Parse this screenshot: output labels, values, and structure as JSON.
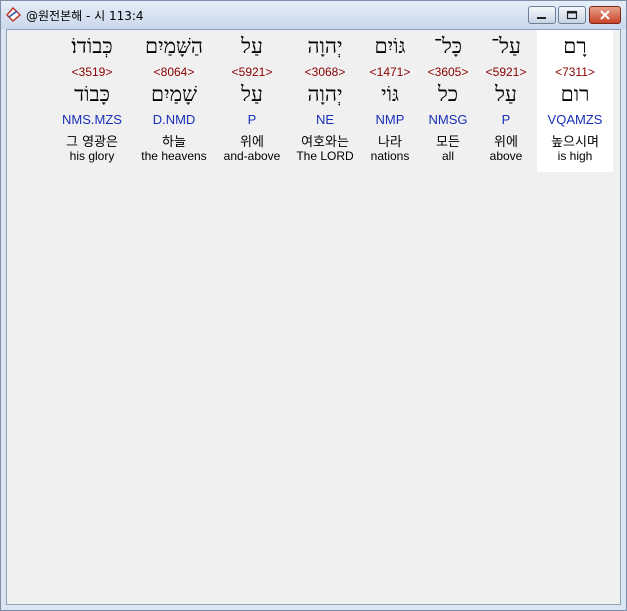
{
  "window": {
    "title": "@원전본해 - 시 113:4"
  },
  "words": [
    {
      "heb": "רָם",
      "strong": "<7311>",
      "lemma": "רום",
      "morph": "VQAMZS",
      "kor": "높으시며",
      "eng": "is high"
    },
    {
      "heb": "עַל־",
      "strong": "<5921>",
      "lemma": "עַל",
      "morph": "P",
      "kor": "위에",
      "eng": "above"
    },
    {
      "heb": "כָּל־",
      "strong": "<3605>",
      "lemma": "כל",
      "morph": "NMSG",
      "kor": "모든",
      "eng": "all"
    },
    {
      "heb": "גּוֹיִם",
      "strong": "<1471>",
      "lemma": "גּוֹי",
      "morph": "NMP",
      "kor": "나라",
      "eng": "nations"
    },
    {
      "heb": "יְהוָה",
      "strong": "<3068>",
      "lemma": "יְהוָה",
      "morph": "NE",
      "kor": "여호와는",
      "eng": "The LORD"
    },
    {
      "heb": "עַל",
      "strong": "<5921>",
      "lemma": "עַל",
      "morph": "P",
      "kor": "위에",
      "eng": "and-above"
    },
    {
      "heb": "הַשָּׁמַיִם",
      "strong": "<8064>",
      "lemma": "שָׁמַיִם",
      "morph": "D.NMD",
      "kor": "하늘",
      "eng": "the heavens"
    },
    {
      "heb": "כְּבוֹדוֹ׃",
      "strong": "<3519>",
      "lemma": "כָּבוֹד",
      "morph": "NMS.MZS",
      "kor": "그 영광은",
      "eng": "his glory"
    }
  ]
}
